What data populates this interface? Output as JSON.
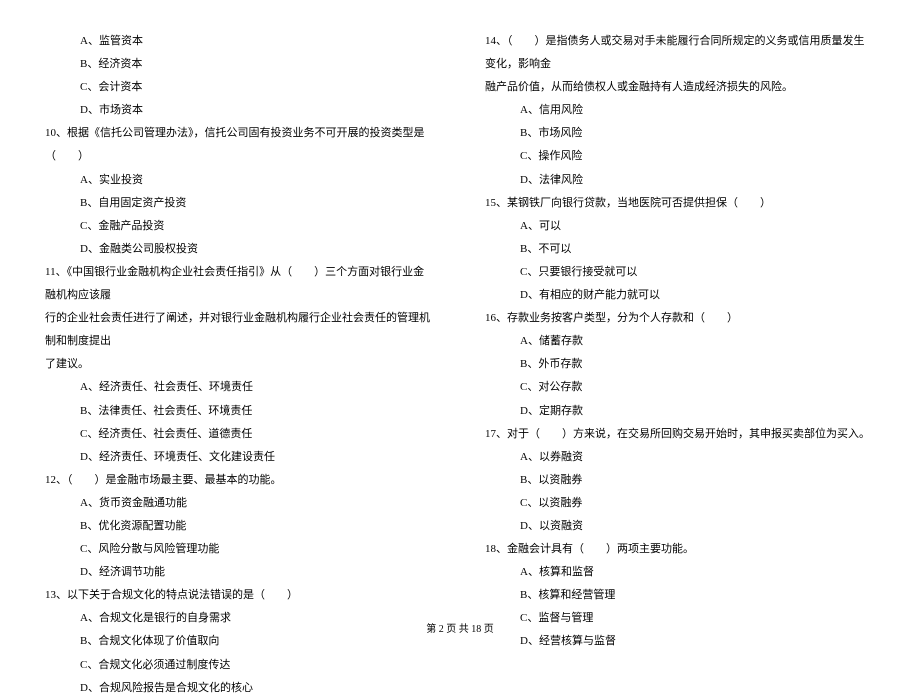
{
  "left_column": {
    "q9_options": [
      "A、监管资本",
      "B、经济资本",
      "C、会计资本",
      "D、市场资本"
    ],
    "q10_text": "10、根据《信托公司管理办法》，信托公司固有投资业务不可开展的投资类型是（　　）",
    "q10_options": [
      "A、实业投资",
      "B、自用固定资产投资",
      "C、金融产品投资",
      "D、金融类公司股权投资"
    ],
    "q11_line1": "11、《中国银行业金融机构企业社会责任指引》从（　　）三个方面对银行业金融机构应该履",
    "q11_line2": "行的企业社会责任进行了阐述，并对银行业金融机构履行企业社会责任的管理机制和制度提出",
    "q11_line3": "了建议。",
    "q11_options": [
      "A、经济责任、社会责任、环境责任",
      "B、法律责任、社会责任、环境责任",
      "C、经济责任、社会责任、道德责任",
      "D、经济责任、环境责任、文化建设责任"
    ],
    "q12_text": "12、（　　）是金融市场最主要、最基本的功能。",
    "q12_options": [
      "A、货币资金融通功能",
      "B、优化资源配置功能",
      "C、风险分散与风险管理功能",
      "D、经济调节功能"
    ],
    "q13_text": "13、以下关于合规文化的特点说法错误的是（　　）",
    "q13_options": [
      "A、合规文化是银行的自身需求",
      "B、合规文化体现了价值取向",
      "C、合规文化必须通过制度传达",
      "D、合规风险报告是合规文化的核心"
    ]
  },
  "right_column": {
    "q14_line1": "14、（　　）是指债务人或交易对手未能履行合同所规定的义务或信用质量发生变化，影响金",
    "q14_line2": "融产品价值，从而给债权人或金融持有人造成经济损失的风险。",
    "q14_options": [
      "A、信用风险",
      "B、市场风险",
      "C、操作风险",
      "D、法律风险"
    ],
    "q15_text": "15、某钢铁厂向银行贷款，当地医院可否提供担保（　　）",
    "q15_options": [
      "A、可以",
      "B、不可以",
      "C、只要银行接受就可以",
      "D、有相应的财产能力就可以"
    ],
    "q16_text": "16、存款业务按客户类型，分为个人存款和（　　）",
    "q16_options": [
      "A、储蓄存款",
      "B、外币存款",
      "C、对公存款",
      "D、定期存款"
    ],
    "q17_text": "17、对于（　　）方来说，在交易所回购交易开始时，其申报买卖部位为买入。",
    "q17_options": [
      "A、以券融资",
      "B、以资融券",
      "C、以资融券",
      "D、以资融资"
    ],
    "q18_text": "18、金融会计具有（　　）两项主要功能。",
    "q18_options": [
      "A、核算和监督",
      "B、核算和经营管理",
      "C、监督与管理",
      "D、经营核算与监督"
    ]
  },
  "footer": "第 2 页 共 18 页"
}
